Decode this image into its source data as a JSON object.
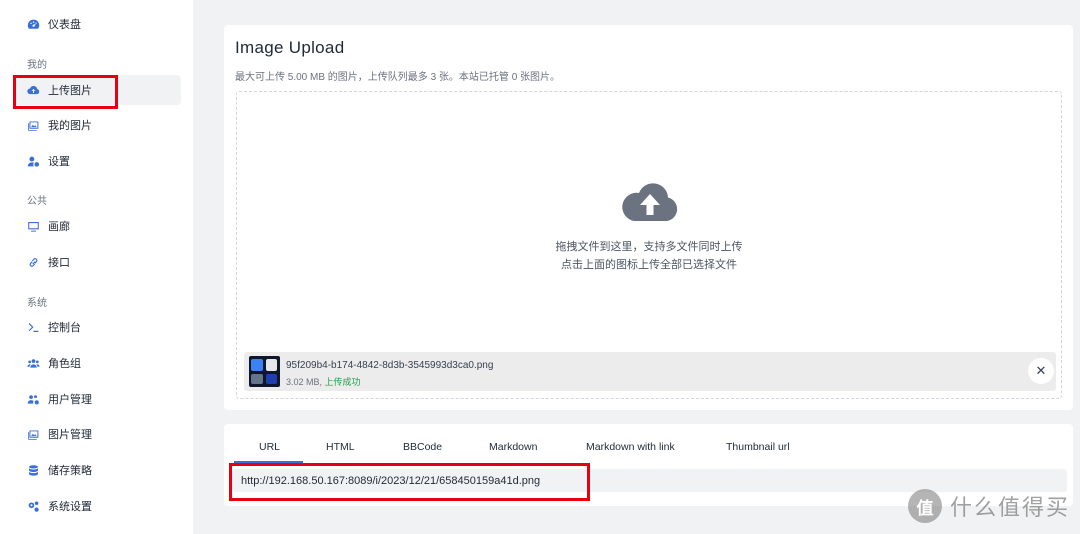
{
  "sidebar": {
    "items": [
      {
        "label": "仪表盘",
        "icon": "dashboard-icon"
      },
      {
        "label": "上传图片",
        "icon": "cloud-upload-icon"
      },
      {
        "label": "我的图片",
        "icon": "images-icon"
      },
      {
        "label": "设置",
        "icon": "user-gear-icon"
      },
      {
        "label": "画廊",
        "icon": "display-icon"
      },
      {
        "label": "接口",
        "icon": "link-icon"
      },
      {
        "label": "控制台",
        "icon": "terminal-icon"
      },
      {
        "label": "角色组",
        "icon": "users-icon"
      },
      {
        "label": "用户管理",
        "icon": "users-gear-icon"
      },
      {
        "label": "图片管理",
        "icon": "images-icon"
      },
      {
        "label": "储存策略",
        "icon": "database-icon"
      },
      {
        "label": "系统设置",
        "icon": "gears-icon"
      }
    ],
    "sections": {
      "mine": "我的",
      "public": "公共",
      "system": "系统"
    }
  },
  "upload": {
    "title": "Image Upload",
    "subtitle": "最大可上传 5.00 MB 的图片，上传队列最多 3 张。本站已托管 0 张图片。",
    "drop_line1": "拖拽文件到这里，支持多文件同时上传",
    "drop_line2": "点击上面的图标上传全部已选择文件",
    "file": {
      "name": "95f209b4-b174-4842-8d3b-3545993d3ca0.png",
      "size": "3.02 MB,",
      "status": "上传成功",
      "remove_label": "✕"
    }
  },
  "result": {
    "tabs": [
      "URL",
      "HTML",
      "BBCode",
      "Markdown",
      "Markdown with link",
      "Thumbnail url"
    ],
    "active_tab": "URL",
    "url": "http://192.168.50.167:8089/i/2023/12/21/658450159a41d.png"
  },
  "watermark": {
    "badge": "值",
    "text": "什么值得买"
  },
  "colors": {
    "accent": "#3b6fd8",
    "highlight": "#e60012",
    "success": "#16a34a"
  }
}
